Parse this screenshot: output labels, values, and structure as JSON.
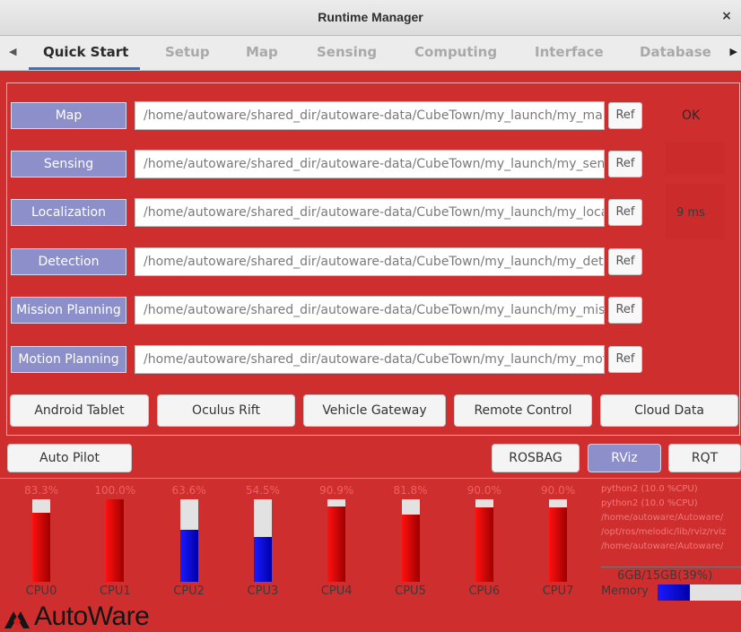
{
  "window": {
    "title": "Runtime Manager",
    "close_glyph": "×"
  },
  "tabs": [
    {
      "label": "Quick Start",
      "active": true
    },
    {
      "label": "Setup"
    },
    {
      "label": "Map"
    },
    {
      "label": "Sensing"
    },
    {
      "label": "Computing"
    },
    {
      "label": "Interface"
    },
    {
      "label": "Database"
    }
  ],
  "tab_scroll": {
    "left_icon": "◀",
    "right_icon": "▶"
  },
  "quick_start": {
    "rows": [
      {
        "button": "Map",
        "path": "/home/autoware/shared_dir/autoware-data/CubeTown/my_launch/my_map.launch",
        "ref": "Ref"
      },
      {
        "button": "Sensing",
        "path": "/home/autoware/shared_dir/autoware-data/CubeTown/my_launch/my_sensing.launch",
        "ref": "Ref"
      },
      {
        "button": "Localization",
        "path": "/home/autoware/shared_dir/autoware-data/CubeTown/my_launch/my_localization.launch",
        "ref": "Ref"
      },
      {
        "button": "Detection",
        "path": "/home/autoware/shared_dir/autoware-data/CubeTown/my_launch/my_detection.launch",
        "ref": "Ref"
      },
      {
        "button": "Mission Planning",
        "path": "/home/autoware/shared_dir/autoware-data/CubeTown/my_launch/my_mission_planning.launch",
        "ref": "Ref"
      },
      {
        "button": "Motion Planning",
        "path": "/home/autoware/shared_dir/autoware-data/CubeTown/my_launch/my_motion_planning.launch",
        "ref": "Ref"
      }
    ],
    "status_ok": "OK",
    "status_ms": "9 ms",
    "apps": [
      "Android Tablet",
      "Oculus Rift",
      "Vehicle Gateway",
      "Remote Control",
      "Cloud Data"
    ]
  },
  "bottom": {
    "auto_pilot": "Auto Pilot",
    "rosbag": "ROSBAG",
    "rviz": "RViz",
    "rqt": "RQT"
  },
  "cpus": [
    {
      "label": "CPU0",
      "pct_text": "83.3%",
      "value": 83.3,
      "color": "red"
    },
    {
      "label": "CPU1",
      "pct_text": "100.0%",
      "value": 100.0,
      "color": "red"
    },
    {
      "label": "CPU2",
      "pct_text": "63.6%",
      "value": 63.6,
      "color": "blue"
    },
    {
      "label": "CPU3",
      "pct_text": "54.5%",
      "value": 54.5,
      "color": "blue"
    },
    {
      "label": "CPU4",
      "pct_text": "90.9%",
      "value": 90.9,
      "color": "red"
    },
    {
      "label": "CPU5",
      "pct_text": "81.8%",
      "value": 81.8,
      "color": "red"
    },
    {
      "label": "CPU6",
      "pct_text": "90.0%",
      "value": 90.0,
      "color": "red"
    },
    {
      "label": "CPU7",
      "pct_text": "90.0%",
      "value": 90.0,
      "color": "red"
    }
  ],
  "processes": [
    "python2 (10.0 %CPU)",
    "python2 (10.0 %CPU)",
    "/home/autoware/Autoware/",
    "/opt/ros/melodic/lib/rviz/rviz",
    "/home/autoware/Autoware/"
  ],
  "memory": {
    "text": "6GB/15GB(39%)",
    "label": "Memory",
    "fraction": 0.39
  },
  "logo": {
    "text": "AutoWare"
  },
  "colors": {
    "accent": "#3b73c4",
    "panel_bg": "#cf2e2e",
    "button_purple": "#8c8fc9",
    "bar_red": "#e00000",
    "bar_blue": "#0000d0"
  }
}
